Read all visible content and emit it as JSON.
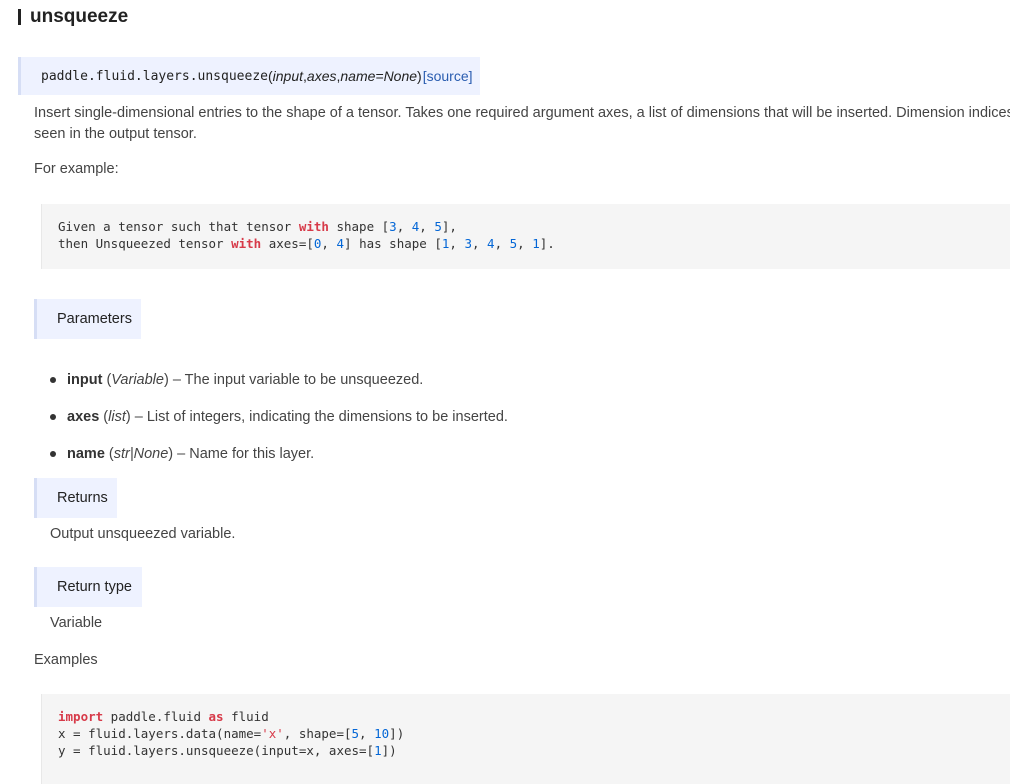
{
  "heading": "unsqueeze",
  "signature": {
    "path": "paddle.fluid.layers.unsqueeze",
    "open_paren": "(",
    "arg1": "input",
    "sep1": ", ",
    "arg2": "axes",
    "sep2": ", ",
    "arg3": "name=None",
    "close_paren": ")",
    "source_label": "[source]"
  },
  "description": {
    "line1": "Insert single-dimensional entries to the shape of a tensor. Takes one required argument axes, a list of dimensions that will be inserted. Dimension indices in axes are as",
    "line2": "seen in the output tensor."
  },
  "for_example_label": "For example:",
  "example_code": {
    "l1a": "Given a tensor such that tensor ",
    "l1kw": "with",
    "l1b": " shape [",
    "l1n1": "3",
    "l1c": ", ",
    "l1n2": "4",
    "l1d": ", ",
    "l1n3": "5",
    "l1e": "],",
    "l2a": "then Unsqueezed tensor ",
    "l2kw": "with",
    "l2b": " axes=[",
    "l2n1": "0",
    "l2c": ", ",
    "l2n2": "4",
    "l2d": "] has shape [",
    "l2n3": "1",
    "l2e": ", ",
    "l2n4": "3",
    "l2f": ", ",
    "l2n5": "4",
    "l2g": ", ",
    "l2n6": "5",
    "l2h": ", ",
    "l2n7": "1",
    "l2i": "]."
  },
  "parameters_label": "Parameters",
  "parameters": [
    {
      "name": "input",
      "open": " (",
      "type": "Variable",
      "close": ")",
      "desc": " – The input variable to be unsqueezed."
    },
    {
      "name": "axes",
      "open": " (",
      "type": "list",
      "close": ")",
      "desc": " – List of integers, indicating the dimensions to be inserted."
    },
    {
      "name": "name",
      "open": " (",
      "type": "str|None",
      "close": ")",
      "desc": " – Name for this layer."
    }
  ],
  "returns_label": "Returns",
  "returns_value": "Output unsqueezed variable.",
  "return_type_label": "Return type",
  "return_type_value": "Variable",
  "examples_label": "Examples",
  "examples_code": {
    "l1kw": "import",
    "l1a": " paddle.fluid ",
    "l1kw2": "as",
    "l1b": " fluid",
    "l2a": "x = fluid.layers.data(name=",
    "l2s": "'x'",
    "l2b": ", shape=[",
    "l2n1": "5",
    "l2c": ", ",
    "l2n2": "10",
    "l2d": "])",
    "l3a": "y = fluid.layers.unsqueeze(input=x, axes=[",
    "l3n1": "1",
    "l3b": "])"
  }
}
